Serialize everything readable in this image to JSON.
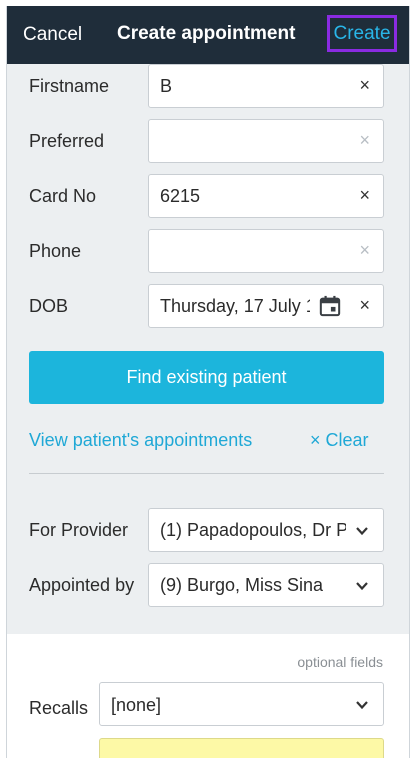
{
  "header": {
    "cancel_label": "Cancel",
    "title": "Create appointment",
    "create_label": "Create"
  },
  "fields": {
    "firstname": {
      "label": "Firstname",
      "value": "B",
      "clear": "×"
    },
    "preferred": {
      "label": "Preferred",
      "value": "",
      "clear": "×"
    },
    "card_no": {
      "label": "Card No",
      "value": "6215",
      "clear": "×"
    },
    "phone": {
      "label": "Phone",
      "value": "",
      "clear": "×"
    },
    "dob": {
      "label": "DOB",
      "value": "Thursday, 17 July 1",
      "clear": "×"
    }
  },
  "actions": {
    "find_label": "Find existing patient",
    "view_label": "View patient's appointments",
    "clear_label": "× Clear"
  },
  "selects": {
    "provider": {
      "label": "For Provider",
      "value": "(1) Papadopoulos, Dr P"
    },
    "appointed_by": {
      "label": "Appointed by",
      "value": "(9) Burgo, Miss Sina"
    }
  },
  "optional": {
    "hint": "optional fields",
    "recalls_label": "Recalls",
    "recalls_value": "[none]"
  },
  "colors": {
    "header_bg": "#1f2d3a",
    "accent": "#1cb5dc",
    "highlight_border": "#8a2be2"
  }
}
